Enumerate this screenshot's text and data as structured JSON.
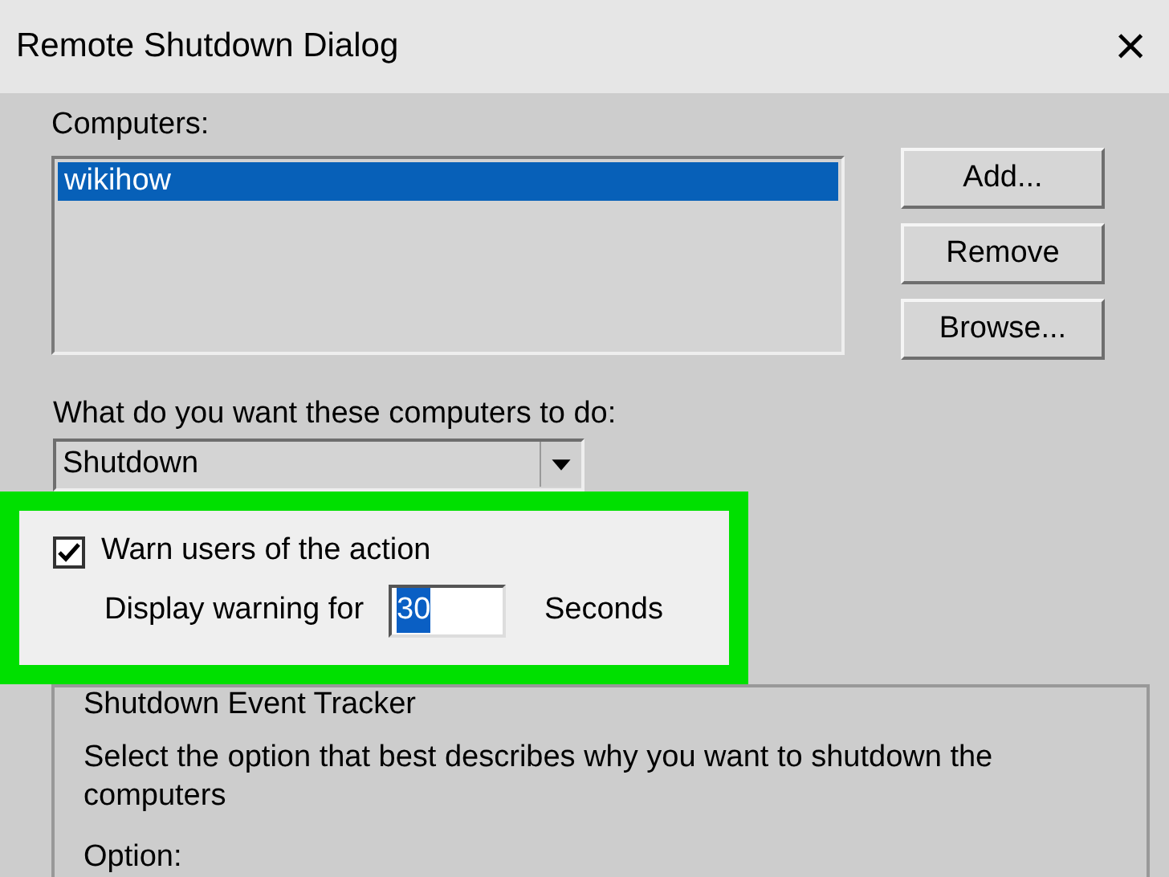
{
  "window": {
    "title": "Remote Shutdown Dialog",
    "close": "×"
  },
  "computers": {
    "label": "Computers:",
    "items": [
      {
        "name": "wikihow",
        "selected": true
      }
    ]
  },
  "buttons": [
    "Add...",
    "Remove",
    "Browse..."
  ],
  "action": {
    "label": "What do you want these computers to do:",
    "value": "Shutdown"
  },
  "warn": {
    "label": "Warn users of the action",
    "checked": true,
    "display_label": "Display warning for",
    "seconds_value": "30",
    "seconds_unit": "Seconds"
  },
  "tracker": {
    "title": "Shutdown Event Tracker",
    "description": "Select the option that best describes why you want to shutdown the computers",
    "option_label": "Option:"
  }
}
